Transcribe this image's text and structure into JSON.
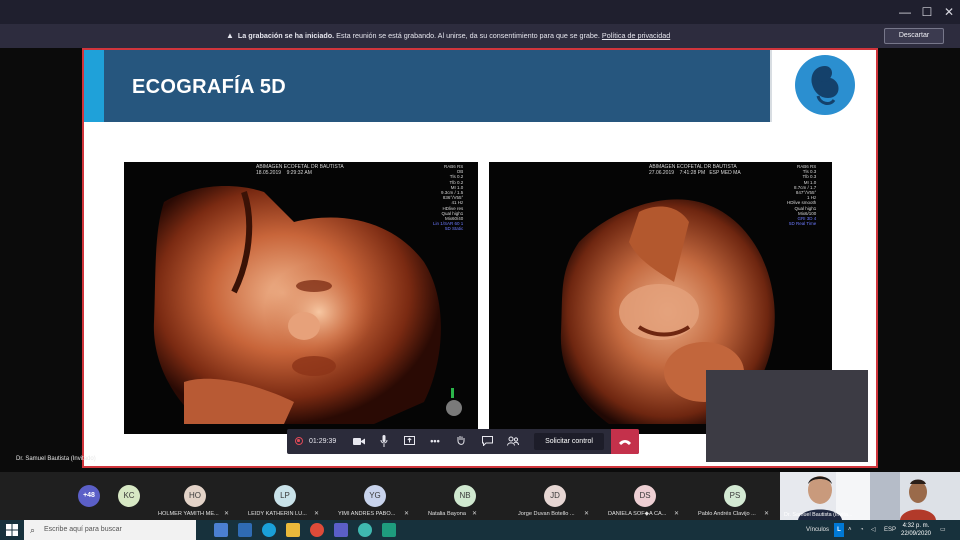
{
  "window": {
    "minimize_glyph": "—",
    "maximize_glyph": "☐",
    "close_glyph": "✕"
  },
  "banner": {
    "icon": "warning-icon",
    "bold_text": "La grabación se ha iniciado.",
    "text": " Esta reunión se está grabando. Al unirse, da su consentimiento para que se grabe. ",
    "link": "Política de privacidad",
    "dismiss_label": "Descartar"
  },
  "slide": {
    "title": "ECOGRAFÍA 5D",
    "logo_icon": "fetus-logo-icon",
    "colors": {
      "header": "#26567e",
      "accent": "#1fa1d9",
      "border": "#d0353c"
    },
    "scans": [
      {
        "header": "ABIMAGEN ECOFETAL DR BAUTISTA",
        "date": "18.05.2019",
        "time": "9:29:32 AM",
        "probe": "RAB6 RS",
        "mode": "OB",
        "params": [
          "Tls 0.2",
          "Tlb 0.2",
          "MI 1.0",
          "9.3cm / 1.5",
          "836°/V55°",
          "41 Hz",
          "HDlive res",
          "Qual high1",
          "Mix60/40",
          "Lin 1/SAR 60 1",
          "5D Static"
        ]
      },
      {
        "header": "ABIMAGEN ECOFETAL DR BAUTISTA",
        "date": "27.06.2019",
        "time": "7:41:28 PM",
        "probe": "RAB6 RS",
        "mode": "ESP MED MA",
        "params": [
          "Tls 0.3",
          "Tlb 0.3",
          "MI 1.0",
          "8.7cm / 1.7",
          "847°/V55°",
          "1 Hz",
          "HDlive smooth",
          "Qual high1",
          "Mix6/100",
          "GRI 3D 4",
          "5D Real Time"
        ]
      }
    ]
  },
  "presenter_label": "Dr. Samuel Bautista (Invitado)",
  "controls": {
    "timer": "01:29:39",
    "request_control": "Solicitar control"
  },
  "participants": {
    "more_count": "+48",
    "list": [
      {
        "initials": "KC",
        "name": "",
        "color": "#d7e8c4"
      },
      {
        "initials": "HO",
        "name": "HOLMER YAMITH ME...",
        "color": "#e3d3c8"
      },
      {
        "initials": "LP",
        "name": "LEIDY KATHERIN LU...",
        "color": "#c9e2e9"
      },
      {
        "initials": "YG",
        "name": "YIMI ANDRES PABO...",
        "color": "#c8d3ec"
      },
      {
        "initials": "NB",
        "name": "Natalia Bayona",
        "color": "#cfe8cf"
      },
      {
        "initials": "JD",
        "name": "Jorge Duvan Botello ...",
        "color": "#e6d6d3"
      },
      {
        "initials": "DS",
        "name": "DANIELA SOF◆A CA...",
        "color": "#edcfd3"
      },
      {
        "initials": "PS",
        "name": "Pablo Andrés Clavijo ...",
        "color": "#d3e9d3"
      }
    ],
    "video_label": "Dr. Samuel Bautista (Invita..."
  },
  "taskbar": {
    "search_placeholder": "Escribe aquí para buscar",
    "tray_label": "Vínculos",
    "tray_badge": "L",
    "language": "ESP",
    "time": "4:32 p. m.",
    "date": "22/09/2020"
  }
}
